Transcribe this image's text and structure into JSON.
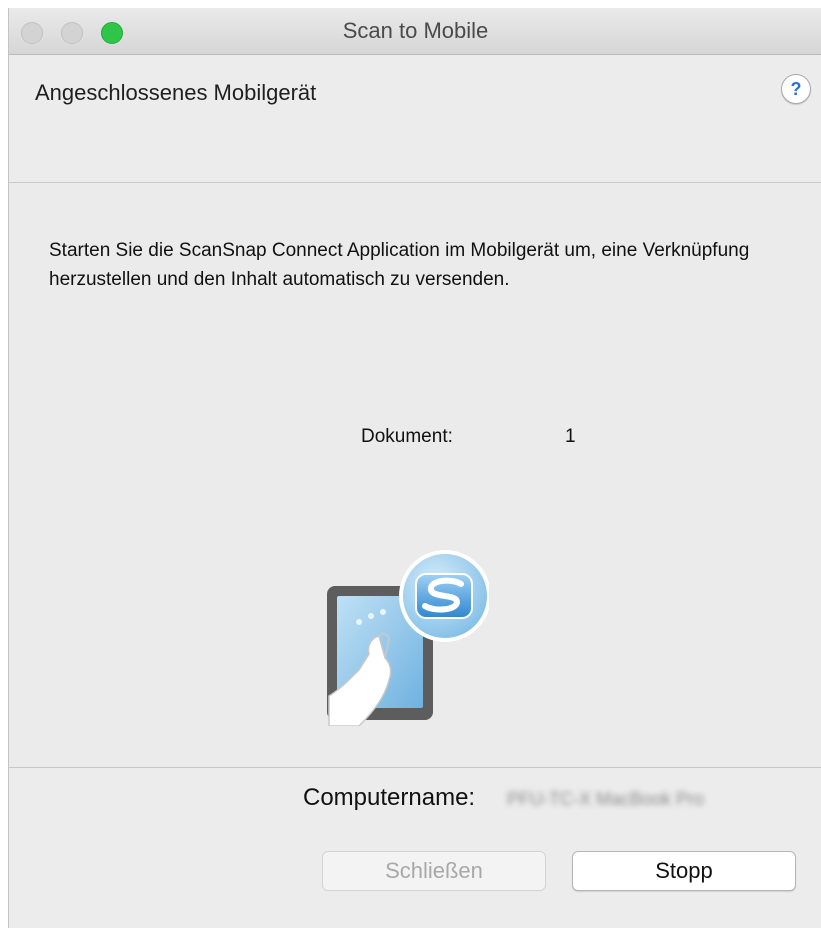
{
  "window": {
    "title": "Scan to Mobile"
  },
  "header": {
    "label": "Angeschlossenes Mobilgerät",
    "help": "?"
  },
  "main": {
    "message": "Starten Sie die ScanSnap Connect Application im Mobilgerät um, eine Verknüpfung herzustellen und den Inhalt automatisch zu versenden.",
    "document_label": "Dokument:",
    "document_count": "1",
    "illustration": "tablet-touch-scansnap-icon"
  },
  "footer": {
    "computer_label": "Computername:",
    "computer_value": "PFU-TC-X MacBook Pro",
    "close_label": "Schließen",
    "stop_label": "Stopp"
  },
  "colors": {
    "zoom_button": "#2ec548",
    "help_glyph": "#2b6fd6",
    "window_bg": "#ececec"
  }
}
